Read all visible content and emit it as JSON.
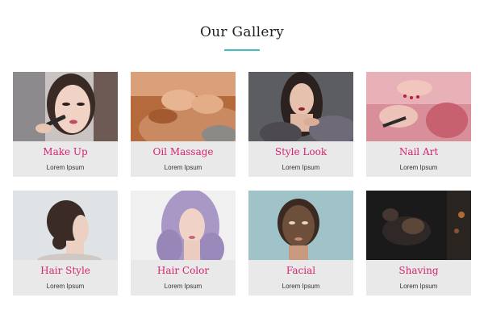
{
  "gallery": {
    "title": "Our Gallery",
    "accent_color": "#3fbfbf",
    "item_title_color": "#d6246e",
    "items": [
      {
        "title": "Make Up",
        "subtitle": "Lorem Ipsum",
        "photo": "makeup-photo"
      },
      {
        "title": "Oil Massage",
        "subtitle": "Lorem Ipsum",
        "photo": "massage-photo"
      },
      {
        "title": "Style Look",
        "subtitle": "Lorem Ipsum",
        "photo": "style-look-photo"
      },
      {
        "title": "Nail Art",
        "subtitle": "Lorem Ipsum",
        "photo": "nail-art-photo"
      },
      {
        "title": "Hair Style",
        "subtitle": "Lorem Ipsum",
        "photo": "hair-style-photo"
      },
      {
        "title": "Hair Color",
        "subtitle": "Lorem Ipsum",
        "photo": "hair-color-photo"
      },
      {
        "title": "Facial",
        "subtitle": "Lorem Ipsum",
        "photo": "facial-photo"
      },
      {
        "title": "Shaving",
        "subtitle": "Lorem Ipsum",
        "photo": "shaving-photo"
      }
    ]
  }
}
